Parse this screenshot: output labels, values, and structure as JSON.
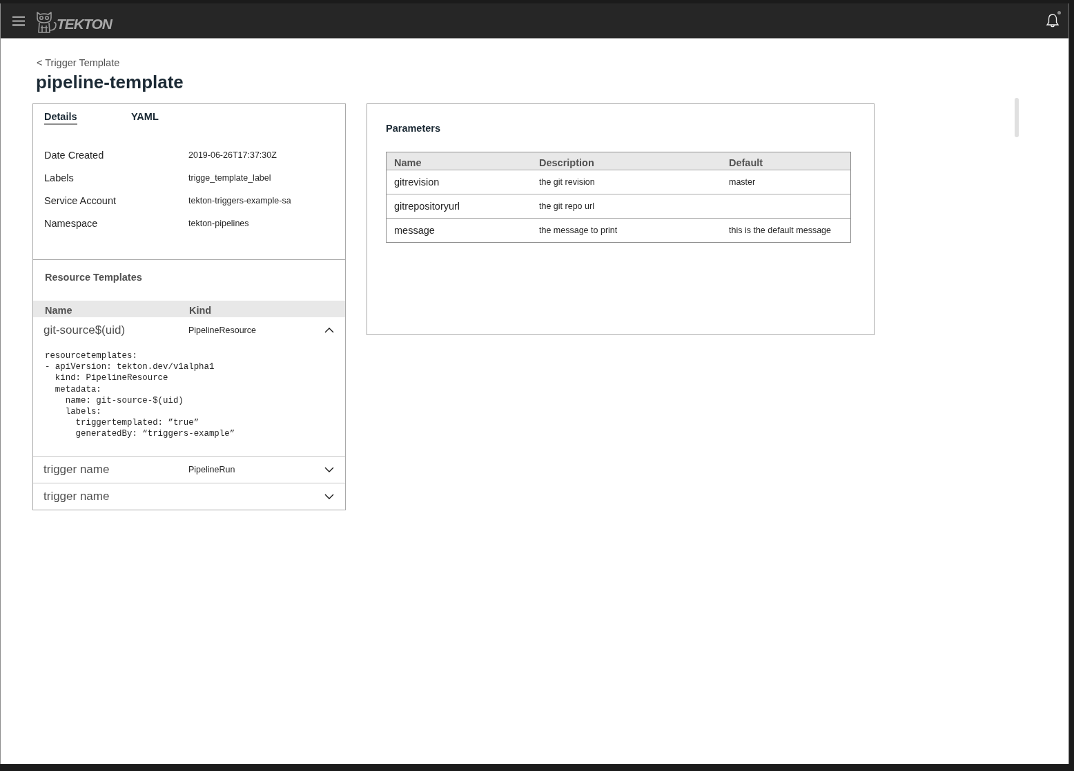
{
  "header": {
    "logo_text": "TEKTON",
    "has_unread": true
  },
  "breadcrumb": "< Trigger Template",
  "title": "pipeline-template",
  "details_card": {
    "tabs": [
      {
        "label": "Details",
        "selected": true
      },
      {
        "label": "YAML",
        "selected": false
      }
    ],
    "fields": [
      {
        "label": "Date Created",
        "value": "2019-06-26T17:37:30Z"
      },
      {
        "label": "Labels",
        "value": "trigge_template_label"
      },
      {
        "label": "Service Account",
        "value": "tekton-triggers-example-sa"
      },
      {
        "label": "Namespace",
        "value": "tekton-pipelines"
      }
    ]
  },
  "resource_templates": {
    "title": "Resource Templates",
    "columns": [
      "Name",
      "Kind"
    ],
    "rows": [
      {
        "name": "git-source$(uid)",
        "resource_kind": "PipelineResource",
        "expanded": true,
        "yaml": "resourcetemplates:\n- apiVersion: tekton.dev/v1alpha1\n  kind: PipelineResource\n  metadata:\n    name: git-source-$(uid)\n    labels:\n      triggertemplated: ”true”\n      generatedBy: “triggers-example”"
      },
      {
        "name": "trigger name",
        "resource_kind": "PipelineRun",
        "expanded": false
      },
      {
        "name": "trigger name",
        "expanded": false
      }
    ]
  },
  "parameters": {
    "title": "Parameters",
    "columns": [
      "Name",
      "Description",
      "Default"
    ],
    "rows": [
      {
        "name": "gitrevision",
        "description": "the git revision",
        "default": "master"
      },
      {
        "name": "gitrepositoryurl",
        "description": "the git repo url"
      },
      {
        "name": "message",
        "description": "the message to print",
        "default": "this is the default message"
      }
    ]
  }
}
